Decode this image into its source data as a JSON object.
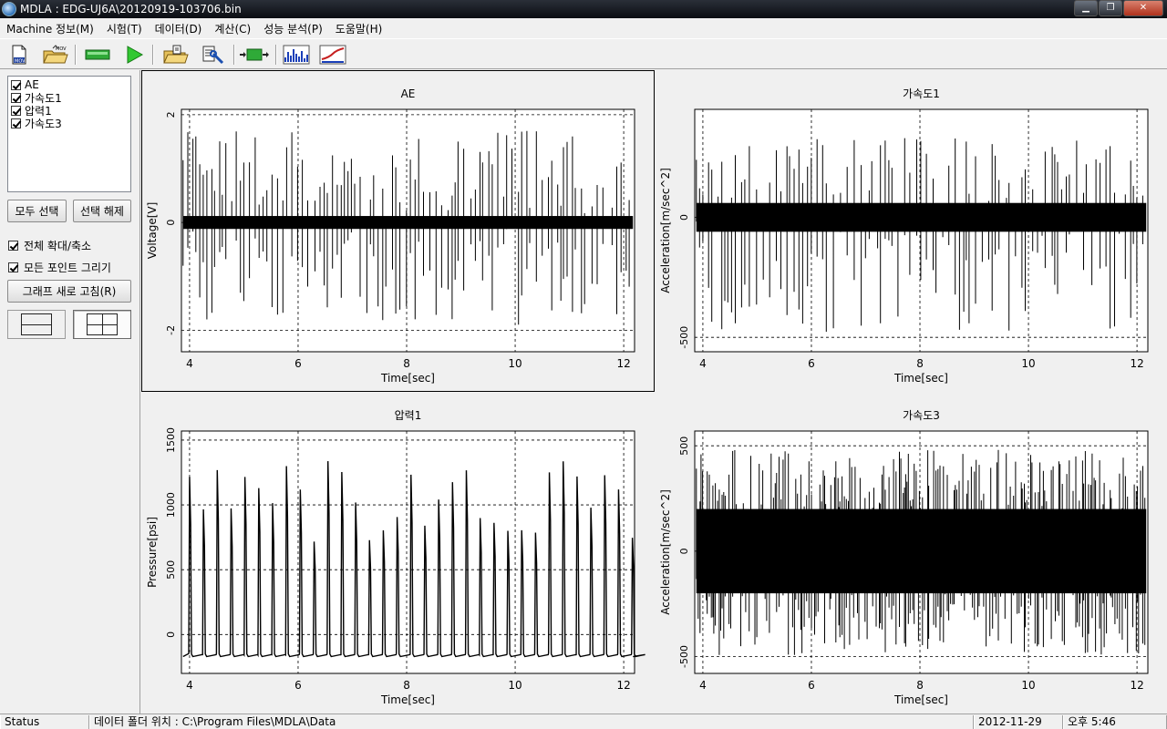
{
  "window": {
    "title": "MDLA : EDG-UJ6A\\20120919-103706.bin",
    "minimize": "▁",
    "maximize": "❐",
    "close": "✕"
  },
  "menu": [
    "Machine 정보(M)",
    "시험(T)",
    "데이터(D)",
    "계산(C)",
    "성능 분석(P)",
    "도움말(H)"
  ],
  "toolbar": {
    "icons": [
      "mov-file-icon",
      "open-mov-folder-icon",
      "green-bar-icon",
      "play-icon",
      "open-folder-icon",
      "settings-tool-icon",
      "export-icon",
      "spectrum-icon",
      "trend-chart-icon"
    ]
  },
  "left_panel": {
    "channels": [
      {
        "label": "AE",
        "checked": true
      },
      {
        "label": "가속도1",
        "checked": true
      },
      {
        "label": "압력1",
        "checked": true
      },
      {
        "label": "가속도3",
        "checked": true
      }
    ],
    "select_all": "모두 선택",
    "deselect": "선택 해제",
    "zoom_all": "전체 확대/축소",
    "draw_all_points": "모든 포인트 그리기",
    "refresh": "그래프 새로 고침(R)",
    "layouts": [
      "two-row-layout-icon",
      "four-grid-layout-icon"
    ]
  },
  "status": {
    "label": "Status",
    "data_folder": "데이터 폴더 위치 : C:\\Program Files\\MDLA\\Data",
    "date": "2012-11-29",
    "time": "오후 5:46"
  },
  "colors": {
    "background": "#f0f0f0",
    "trace": "#000000"
  },
  "chart_data": [
    {
      "type": "line",
      "title": "AE",
      "xlabel": "Time[sec]",
      "ylabel": "Voltage[V]",
      "xlim": [
        3.85,
        12.2
      ],
      "ylim": [
        -2.4,
        2.1
      ],
      "xticks": [
        4,
        6,
        8,
        10,
        12
      ],
      "yticks": [
        2,
        0,
        -2
      ],
      "grid": "dashed",
      "series": [
        {
          "baseline": 0,
          "noise_band": 0.12,
          "spike_range": [
            -1.9,
            1.7
          ],
          "spike_interval_sec": 0.09
        }
      ]
    },
    {
      "type": "line",
      "title": "가속도1",
      "xlabel": "Time[sec]",
      "ylabel": "Acceleration[m/sec^2]",
      "xlim": [
        3.85,
        12.2
      ],
      "ylim": [
        -560,
        450
      ],
      "xticks": [
        4,
        6,
        8,
        10,
        12
      ],
      "yticks": [
        0,
        -500
      ],
      "grid": "dashed",
      "series": [
        {
          "baseline": 0,
          "noise_band": 60,
          "spike_range": [
            -480,
            330
          ],
          "spike_interval_sec": 0.09
        }
      ]
    },
    {
      "type": "line",
      "title": "압력1",
      "xlabel": "Time[sec]",
      "ylabel": "Pressure[psi]",
      "xlim": [
        3.85,
        12.2
      ],
      "ylim": [
        -300,
        1570
      ],
      "xticks": [
        4,
        6,
        8,
        10,
        12
      ],
      "yticks": [
        1500,
        1000,
        500,
        0
      ],
      "grid": "dashed",
      "series": [
        {
          "baseline": -170,
          "peak_range": [
            700,
            1370
          ],
          "pulse_period_sec": 0.255,
          "pulse_start_sec": 4.0
        }
      ]
    },
    {
      "type": "line",
      "title": "가속도3",
      "xlabel": "Time[sec]",
      "ylabel": "Acceleration[m/sec^2]",
      "xlim": [
        3.85,
        12.2
      ],
      "ylim": [
        -580,
        570
      ],
      "xticks": [
        4,
        6,
        8,
        10,
        12
      ],
      "yticks": [
        500,
        0,
        -500
      ],
      "grid": "dashed",
      "series": [
        {
          "baseline": 0,
          "noise_band": 200,
          "spike_range": [
            -500,
            480
          ],
          "spike_interval_sec": 0.03
        }
      ]
    }
  ]
}
